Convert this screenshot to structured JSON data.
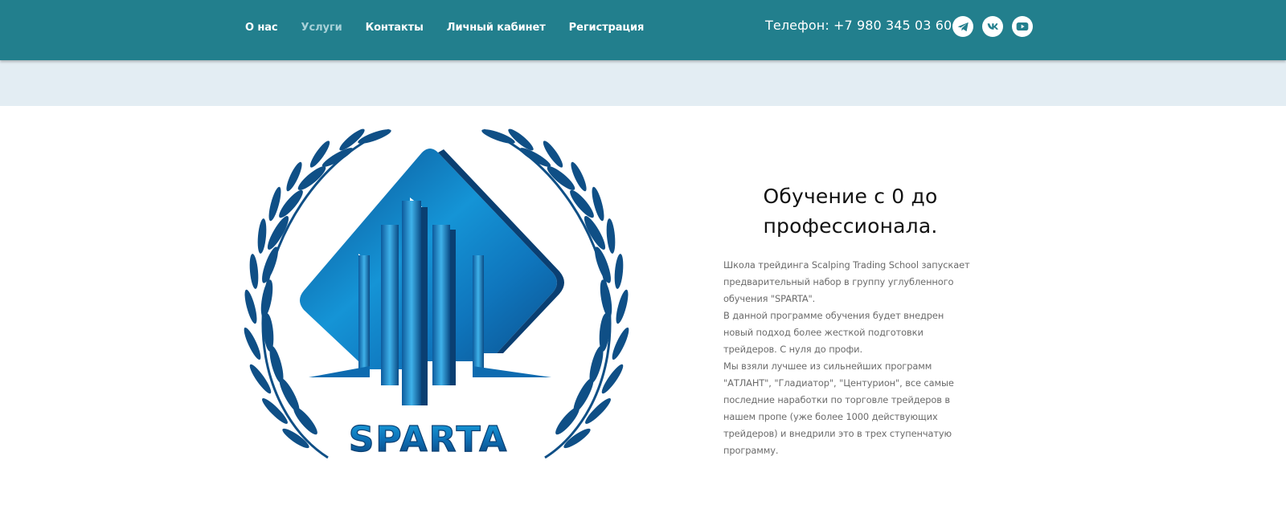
{
  "nav": {
    "items": [
      {
        "label": "О нас",
        "active": false
      },
      {
        "label": "Услуги",
        "active": true
      },
      {
        "label": "Контакты",
        "active": false
      },
      {
        "label": "Личный кабинет",
        "active": false
      },
      {
        "label": "Регистрация",
        "active": false
      }
    ]
  },
  "header": {
    "phone": "Телефон: +7 980 345 03 60",
    "socials": [
      "telegram-icon",
      "vk-icon",
      "youtube-icon"
    ]
  },
  "colors": {
    "header_bg": "#227f8d",
    "nav_active": "#a7d1d8",
    "band_bg": "#e3edf3",
    "logo_blue": "#0d6bb0",
    "laurel": "#0f4f86"
  },
  "hero": {
    "logo_text": "SPARTA",
    "title": "Обучение с 0 до профессионала.",
    "paragraphs": [
      "Школа трейдинга Scalping Trading School запускает предварительный набор в группу углубленного обучения \"SPARTA\".",
      "В данной программе обучения будет внедрен новый подход более жесткой подготовки трейдеров. С нуля до профи.",
      "Мы взяли лучшее из сильнейших программ \"АТЛАНТ\", \"Гладиатор\", \"Центурион\", все самые последние наработки по торговле трейдеров в нашем пропе (уже более 1000 действующих трейдеров) и внедрили это в трех ступенчатую программу."
    ]
  }
}
